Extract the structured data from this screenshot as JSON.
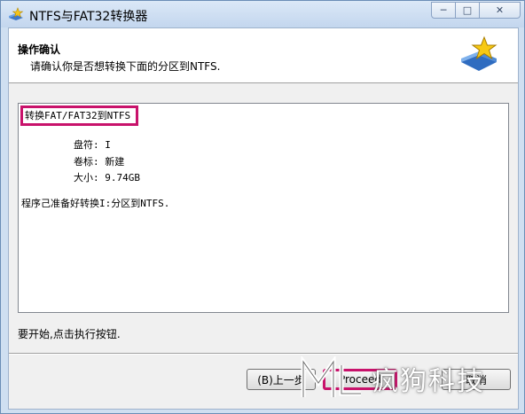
{
  "window": {
    "title": "NTFS与FAT32转换器",
    "controls": {
      "minimize": "─",
      "maximize": "□",
      "close": "✕"
    }
  },
  "header": {
    "title": "操作确认",
    "subtitle": "请确认你是否想转换下面的分区到NTFS."
  },
  "info": {
    "operation_title": "转换FAT/FAT32到NTFS",
    "fields": [
      {
        "label": "盘符:",
        "value": "I"
      },
      {
        "label": "卷标:",
        "value": "新建"
      },
      {
        "label": "大小:",
        "value": "9.74GB"
      }
    ],
    "status": "程序己准备好转换I:分区到NTFS."
  },
  "hint": "要开始,点击执行按钮.",
  "buttons": {
    "back": "(B)上一步",
    "proceed": "Proceed",
    "cancel": "取消"
  },
  "watermark": {
    "text": "疯狗科技"
  },
  "colors": {
    "highlight": "#c8126b",
    "title_gradient_top": "#dbe8f7",
    "content_bg": "#f0f0f0"
  }
}
